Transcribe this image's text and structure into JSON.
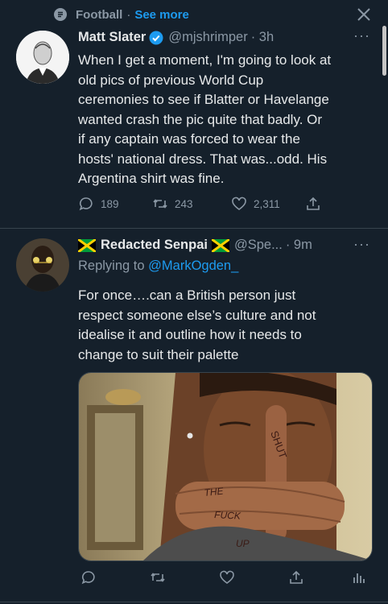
{
  "topic": {
    "name": "Football",
    "separator": "·",
    "see_more": "See more"
  },
  "tweet1": {
    "name": "Matt Slater",
    "handle": "@mjshrimper",
    "time": "· 3h",
    "body_lines": [
      "When I get a moment, I'm going to look at",
      "old pics of previous World Cup",
      "ceremonies to see if Blatter or Havelange",
      "wanted crash the pic quite that badly. Or",
      "if any captain was forced to wear the",
      "hosts' national dress. That was...odd. His",
      "Argentina shirt was fine."
    ],
    "replies": "189",
    "retweets": "243",
    "likes": "2,311"
  },
  "tweet2": {
    "name": "Redacted Senpai",
    "handle": "@Spe...",
    "time": "· 9m",
    "replying_prefix": "Replying to",
    "replying_handle": "@MarkOgden_",
    "body_lines": [
      "For once….can a British person just",
      "respect someone else’s culture and not",
      "idealise it and outline how it needs to",
      "change to suit their palette"
    ],
    "image_text": [
      "SHUT",
      "THE",
      "FUCK",
      "UP"
    ]
  },
  "colors": {
    "background": "#15202b",
    "accent": "#1d9bf0",
    "muted": "#8b98a5",
    "text": "#e7e9ea"
  },
  "icons": [
    "topic-icon",
    "close-icon",
    "verified-icon",
    "more-icon",
    "reply-icon",
    "retweet-icon",
    "like-icon",
    "share-icon",
    "analytics-icon",
    "jamaica-flag-icon"
  ]
}
